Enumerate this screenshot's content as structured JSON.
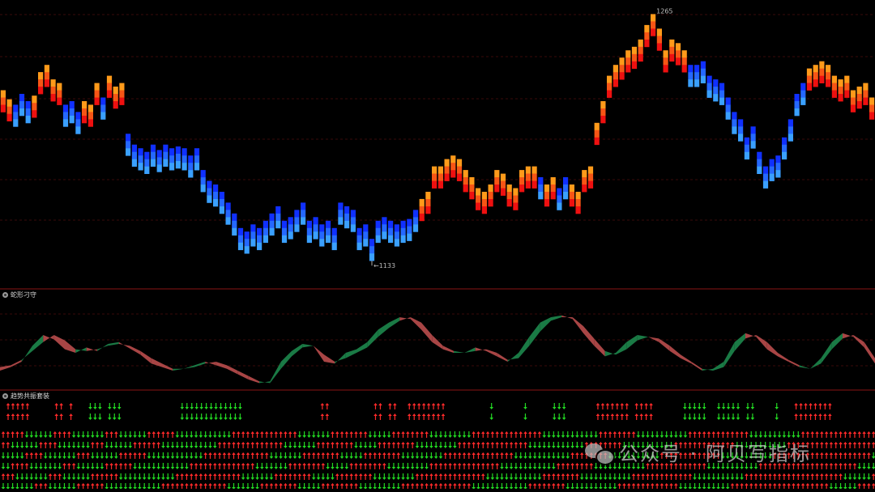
{
  "panels": {
    "ma_title": "蛇形刁守",
    "arrow_title": "趋势共振套装"
  },
  "watermark": "公众号 · 阿贝写指标",
  "colors": {
    "background": "#000000",
    "grid": "#3a0a0a",
    "separator": "#8a1414",
    "up_top": "#ff9a1a",
    "up_bottom": "#ee1010",
    "down_top": "#1030ff",
    "down_bottom": "#3aa0ff",
    "ribbon_up": "#1a7a45",
    "ribbon_down": "#a84545",
    "arrow_up": "#ff2a2a",
    "arrow_down": "#22d822"
  },
  "chart_data": [
    {
      "type": "bar",
      "description_of_marks": "segmented trend bars",
      "low_label": "1133",
      "high_label": "1265",
      "ylim": [
        1120,
        1270
      ],
      "values": [
        1222,
        1217,
        1214,
        1220,
        1216,
        1219,
        1232,
        1236,
        1228,
        1226,
        1214,
        1216,
        1210,
        1216,
        1214,
        1226,
        1218,
        1230,
        1224,
        1226,
        1198,
        1192,
        1190,
        1188,
        1192,
        1189,
        1192,
        1190,
        1191,
        1190,
        1186,
        1190,
        1178,
        1172,
        1170,
        1166,
        1160,
        1154,
        1146,
        1144,
        1148,
        1146,
        1150,
        1154,
        1158,
        1150,
        1152,
        1156,
        1160,
        1150,
        1152,
        1148,
        1150,
        1146,
        1160,
        1158,
        1156,
        1146,
        1148,
        1140,
        1150,
        1152,
        1150,
        1148,
        1150,
        1151,
        1156,
        1162,
        1166,
        1180,
        1180,
        1184,
        1186,
        1184,
        1178,
        1174,
        1168,
        1166,
        1170,
        1178,
        1176,
        1170,
        1168,
        1178,
        1180,
        1180,
        1174,
        1170,
        1174,
        1168,
        1174,
        1170,
        1166,
        1178,
        1180,
        1204,
        1216,
        1230,
        1236,
        1240,
        1244,
        1246,
        1250,
        1258,
        1264,
        1256,
        1244,
        1250,
        1248,
        1244,
        1236,
        1236,
        1238,
        1230,
        1228,
        1226,
        1218,
        1210,
        1206,
        1196,
        1202,
        1188,
        1180,
        1184,
        1186,
        1196,
        1206,
        1220,
        1226,
        1234,
        1236,
        1238,
        1236,
        1230,
        1228,
        1230,
        1222,
        1224,
        1226,
        1218
      ],
      "trend": [
        "up",
        "up",
        "down",
        "down",
        "down",
        "up",
        "up",
        "up",
        "up",
        "up",
        "down",
        "down",
        "down",
        "up",
        "up",
        "up",
        "down",
        "up",
        "up",
        "up",
        "down",
        "down",
        "down",
        "down",
        "down",
        "down",
        "down",
        "down",
        "down",
        "down",
        "down",
        "down",
        "down",
        "down",
        "down",
        "down",
        "down",
        "down",
        "down",
        "down",
        "down",
        "down",
        "down",
        "down",
        "down",
        "down",
        "down",
        "down",
        "down",
        "down",
        "down",
        "down",
        "down",
        "down",
        "down",
        "down",
        "down",
        "down",
        "down",
        "down",
        "down",
        "down",
        "down",
        "down",
        "down",
        "down",
        "down",
        "up",
        "up",
        "up",
        "up",
        "up",
        "up",
        "up",
        "up",
        "up",
        "up",
        "up",
        "up",
        "up",
        "up",
        "up",
        "up",
        "up",
        "up",
        "up",
        "down",
        "up",
        "up",
        "down",
        "down",
        "up",
        "up",
        "up",
        "up",
        "up",
        "up",
        "up",
        "up",
        "up",
        "up",
        "up",
        "up",
        "up",
        "up",
        "up",
        "up",
        "up",
        "up",
        "up",
        "down",
        "down",
        "down",
        "down",
        "down",
        "down",
        "down",
        "down",
        "down",
        "down",
        "down",
        "down",
        "down",
        "down",
        "down",
        "down",
        "down",
        "down",
        "down",
        "up",
        "up",
        "up",
        "up",
        "up",
        "up",
        "up",
        "up",
        "up",
        "up",
        "up"
      ]
    },
    {
      "type": "area",
      "description_of_marks": "two-line ribbon filled green when rising, red when falling",
      "ylim": [
        0,
        100
      ],
      "fast": [
        20,
        24,
        30,
        48,
        60,
        55,
        44,
        40,
        46,
        42,
        50,
        52,
        45,
        38,
        28,
        24,
        20,
        22,
        26,
        30,
        26,
        22,
        16,
        10,
        6,
        8,
        30,
        42,
        50,
        48,
        30,
        28,
        40,
        44,
        52,
        66,
        74,
        80,
        78,
        66,
        52,
        44,
        40,
        40,
        46,
        42,
        36,
        30,
        40,
        58,
        74,
        80,
        82,
        78,
        62,
        48,
        36,
        40,
        52,
        60,
        58,
        52,
        42,
        34,
        28,
        20,
        22,
        30,
        52,
        62,
        58,
        44,
        36,
        30,
        24,
        22,
        34,
        52,
        62,
        58,
        46,
        28
      ],
      "slow": [
        24,
        26,
        32,
        42,
        52,
        60,
        54,
        44,
        42,
        44,
        48,
        50,
        48,
        42,
        34,
        28,
        22,
        22,
        24,
        28,
        30,
        26,
        20,
        14,
        8,
        6,
        22,
        36,
        46,
        48,
        38,
        30,
        34,
        40,
        46,
        58,
        68,
        76,
        80,
        74,
        60,
        48,
        42,
        40,
        42,
        44,
        40,
        32,
        34,
        48,
        64,
        76,
        80,
        80,
        70,
        56,
        42,
        38,
        44,
        54,
        58,
        56,
        48,
        38,
        30,
        22,
        20,
        24,
        42,
        56,
        60,
        52,
        40,
        32,
        26,
        22,
        28,
        44,
        56,
        60,
        52,
        34
      ]
    }
  ],
  "arrow_rows": {
    "upper": "UUUUU~~~~~UU~U~~~DDD~DDD~~~~~~~~~~~~DDDDDDDDDDDDD~~~~~~~~~~~~~~~~UU~~~~~~~~~UU~UU~~UUUUUUUU~~~~~~~~~D~~~~~~D~~~~~DDD~~~~~~UUUUUUU~UUUU~~~~~~DDDDD~~DDDDD~DD~~~~D~~~UUUUUUUU~~~~~~~~~~",
    "lower": "UUUUUDDDDDDUUUUDDDDDDDUUUDDDDDDUUUUUUDDDDDDDDDDDDUUUUUUUUUUUUUUDDDDDDDUUUUUUUUDDDDDUUUUUUUUDDDDDDDDDUUUUUUUUUUUUUUUDDDDDDDDDDDDUUUUUUUUDDDDDDDDDDDUUUUUUUUUUUUUDDDDDDDDDDDUUUUUUUUUUUUUUUU"
  }
}
